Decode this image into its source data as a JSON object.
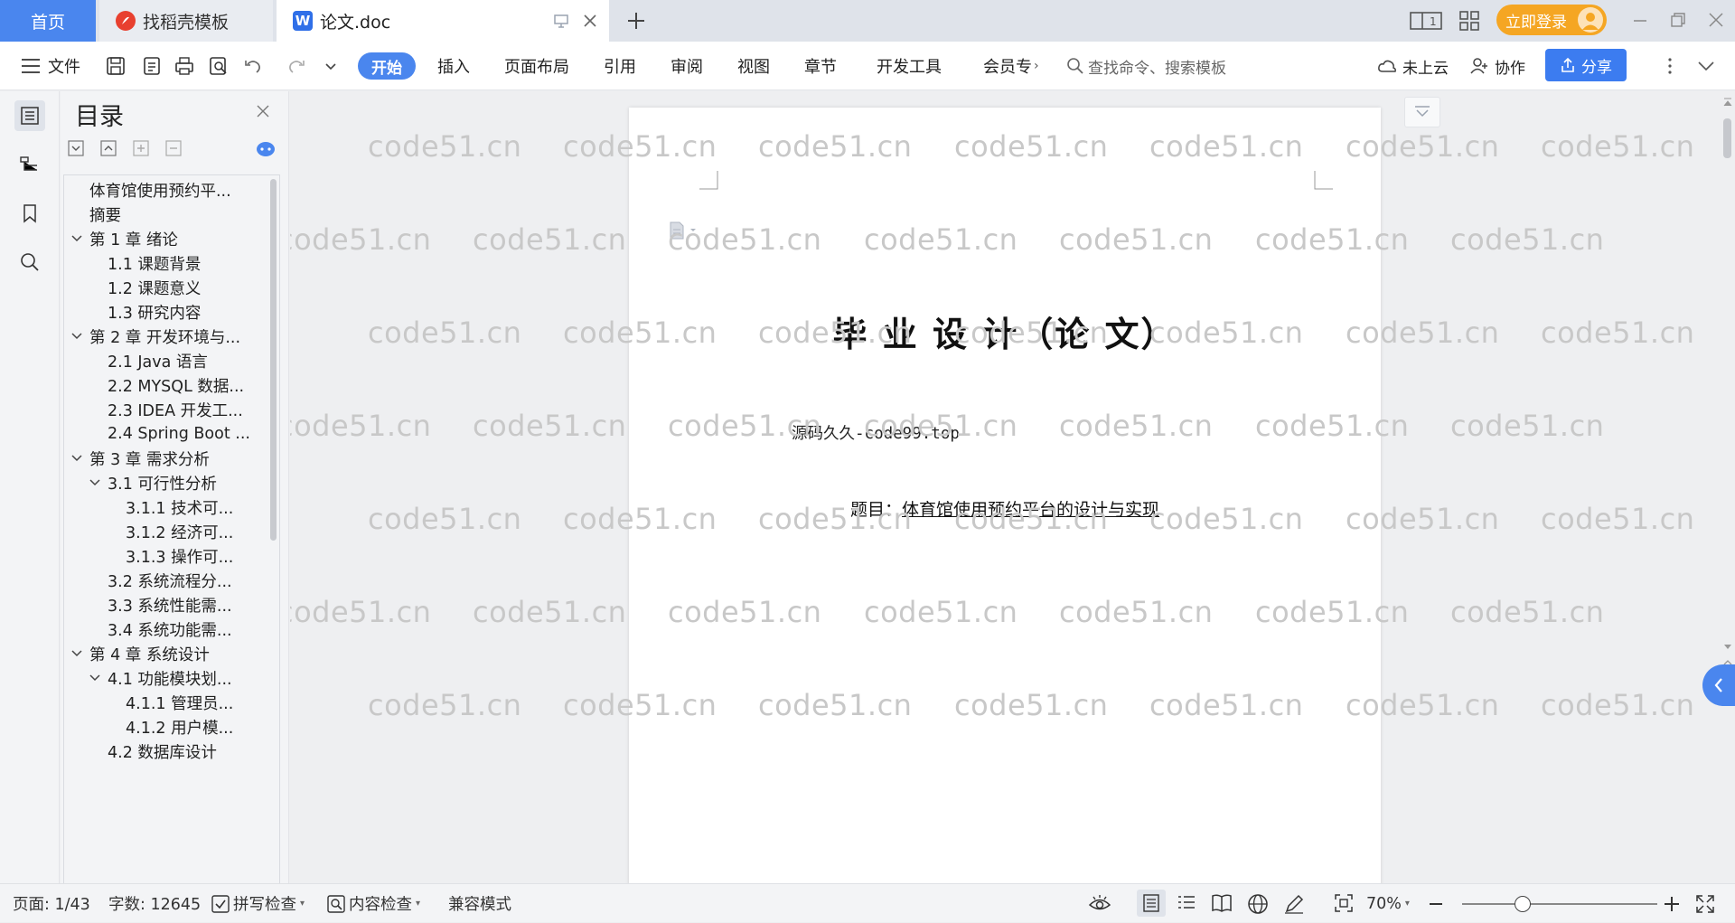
{
  "tabs": {
    "home": "首页",
    "template": "找稻壳模板",
    "document": "论文.doc",
    "login": "立即登录"
  },
  "menu": {
    "file": "文件",
    "start": "开始",
    "insert": "插入",
    "layout": "页面布局",
    "reference": "引用",
    "review": "审阅",
    "view": "视图",
    "chapter": "章节",
    "developer": "开发工具",
    "member": "会员专",
    "search_placeholder": "查找命令、搜索模板",
    "cloud": "未上云",
    "collab": "协作",
    "share": "分享"
  },
  "toc": {
    "title": "目录",
    "items": [
      {
        "text": "体育馆使用预约平...",
        "level": 0,
        "chevron": false
      },
      {
        "text": "摘要",
        "level": 0,
        "chevron": false
      },
      {
        "text": "第 1 章  绪论",
        "level": 0,
        "chevron": true
      },
      {
        "text": "1.1  课题背景",
        "level": 1,
        "chevron": false
      },
      {
        "text": "1.2  课题意义",
        "level": 1,
        "chevron": false
      },
      {
        "text": "1.3  研究内容",
        "level": 1,
        "chevron": false
      },
      {
        "text": "第 2 章  开发环境与...",
        "level": 0,
        "chevron": true
      },
      {
        "text": "2.1 Java 语言",
        "level": 1,
        "chevron": false
      },
      {
        "text": "2.2 MYSQL 数据...",
        "level": 1,
        "chevron": false
      },
      {
        "text": "2.3 IDEA 开发工...",
        "level": 1,
        "chevron": false
      },
      {
        "text": "2.4 Spring Boot ...",
        "level": 1,
        "chevron": false
      },
      {
        "text": "第 3 章  需求分析",
        "level": 0,
        "chevron": true
      },
      {
        "text": "3.1  可行性分析",
        "level": 1,
        "chevron": true
      },
      {
        "text": "3.1.1  技术可...",
        "level": 2,
        "chevron": false
      },
      {
        "text": "3.1.2  经济可...",
        "level": 2,
        "chevron": false
      },
      {
        "text": "3.1.3  操作可...",
        "level": 2,
        "chevron": false
      },
      {
        "text": "3.2  系统流程分...",
        "level": 1,
        "chevron": false
      },
      {
        "text": "3.3  系统性能需...",
        "level": 1,
        "chevron": false
      },
      {
        "text": "3.4  系统功能需...",
        "level": 1,
        "chevron": false
      },
      {
        "text": "第 4 章  系统设计",
        "level": 0,
        "chevron": true
      },
      {
        "text": "4.1  功能模块划...",
        "level": 1,
        "chevron": true
      },
      {
        "text": "4.1.1  管理员...",
        "level": 2,
        "chevron": false
      },
      {
        "text": "4.1.2  用户模...",
        "level": 2,
        "chevron": false
      },
      {
        "text": "4.2  数据库设计",
        "level": 1,
        "chevron": false
      }
    ]
  },
  "document": {
    "heading": "毕 业 设 计（论 文）",
    "source": "源码久久-code99.top",
    "title_label": "题目：",
    "title_value": "体育馆使用预约平台的设计与实现"
  },
  "watermark": "code51.cn",
  "status": {
    "page": "页面: 1/43",
    "words": "字数: 12645",
    "spell": "拼写检查",
    "content": "内容检查",
    "compat": "兼容模式",
    "zoom": "70%"
  },
  "colors": {
    "accent": "#4a86ee",
    "login": "#f5a623",
    "share": "#3c7cf0"
  }
}
